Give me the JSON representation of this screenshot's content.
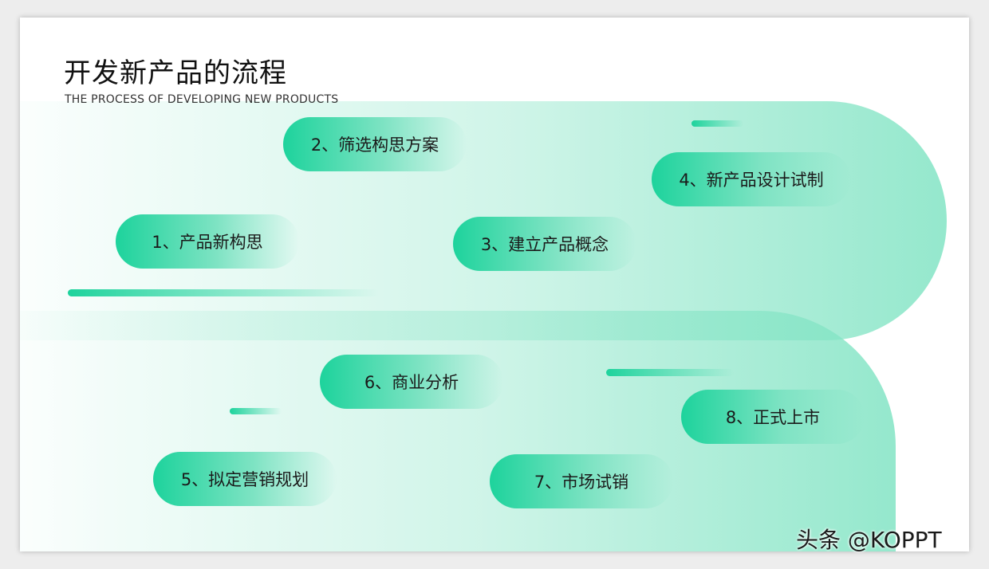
{
  "slide": {
    "title": "开发新产品的流程",
    "subtitle": "THE PROCESS OF DEVELOPING NEW PRODUCTS"
  },
  "steps": [
    "1、产品新构思",
    "2、筛选构思方案",
    "3、建立产品概念",
    "4、新产品设计试制",
    "5、拟定营销规划",
    "6、商业分析",
    "7、市场试销",
    "8、正式上市"
  ],
  "watermark": "头条 @KOPPT",
  "colors": {
    "accent": "#1dd39c",
    "band": "#96e8cd",
    "background": "#ffffff"
  }
}
